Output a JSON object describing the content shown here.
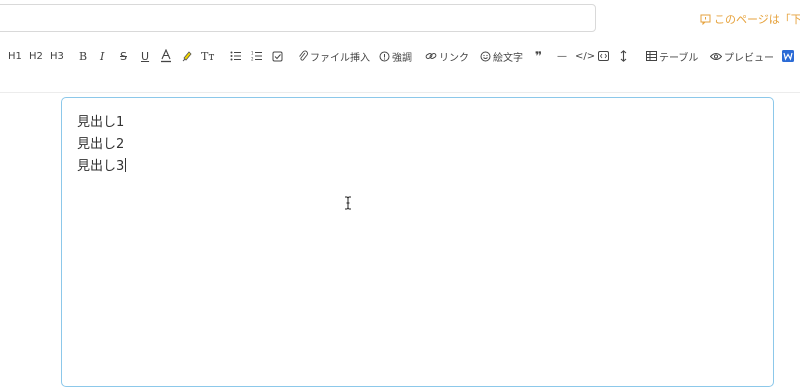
{
  "notice": {
    "text": "このページは「下書",
    "color": "#e6a23c"
  },
  "toolbar": {
    "h1": "H1",
    "h2": "H2",
    "h3": "H3",
    "bold": "B",
    "italic": "I",
    "strike": "S",
    "underline": "U",
    "font_size": "Tт",
    "file_insert": "ファイル挿入",
    "emphasis": "強調",
    "link": "リンク",
    "emoji": "絵文字",
    "quote": "❞",
    "hr": "—",
    "code": "</>",
    "table": "テーブル",
    "preview": "プレビュー"
  },
  "editor": {
    "lines": [
      "見出し1",
      "見出し2",
      "見出し3"
    ],
    "border_color": "#8cc8ea"
  }
}
